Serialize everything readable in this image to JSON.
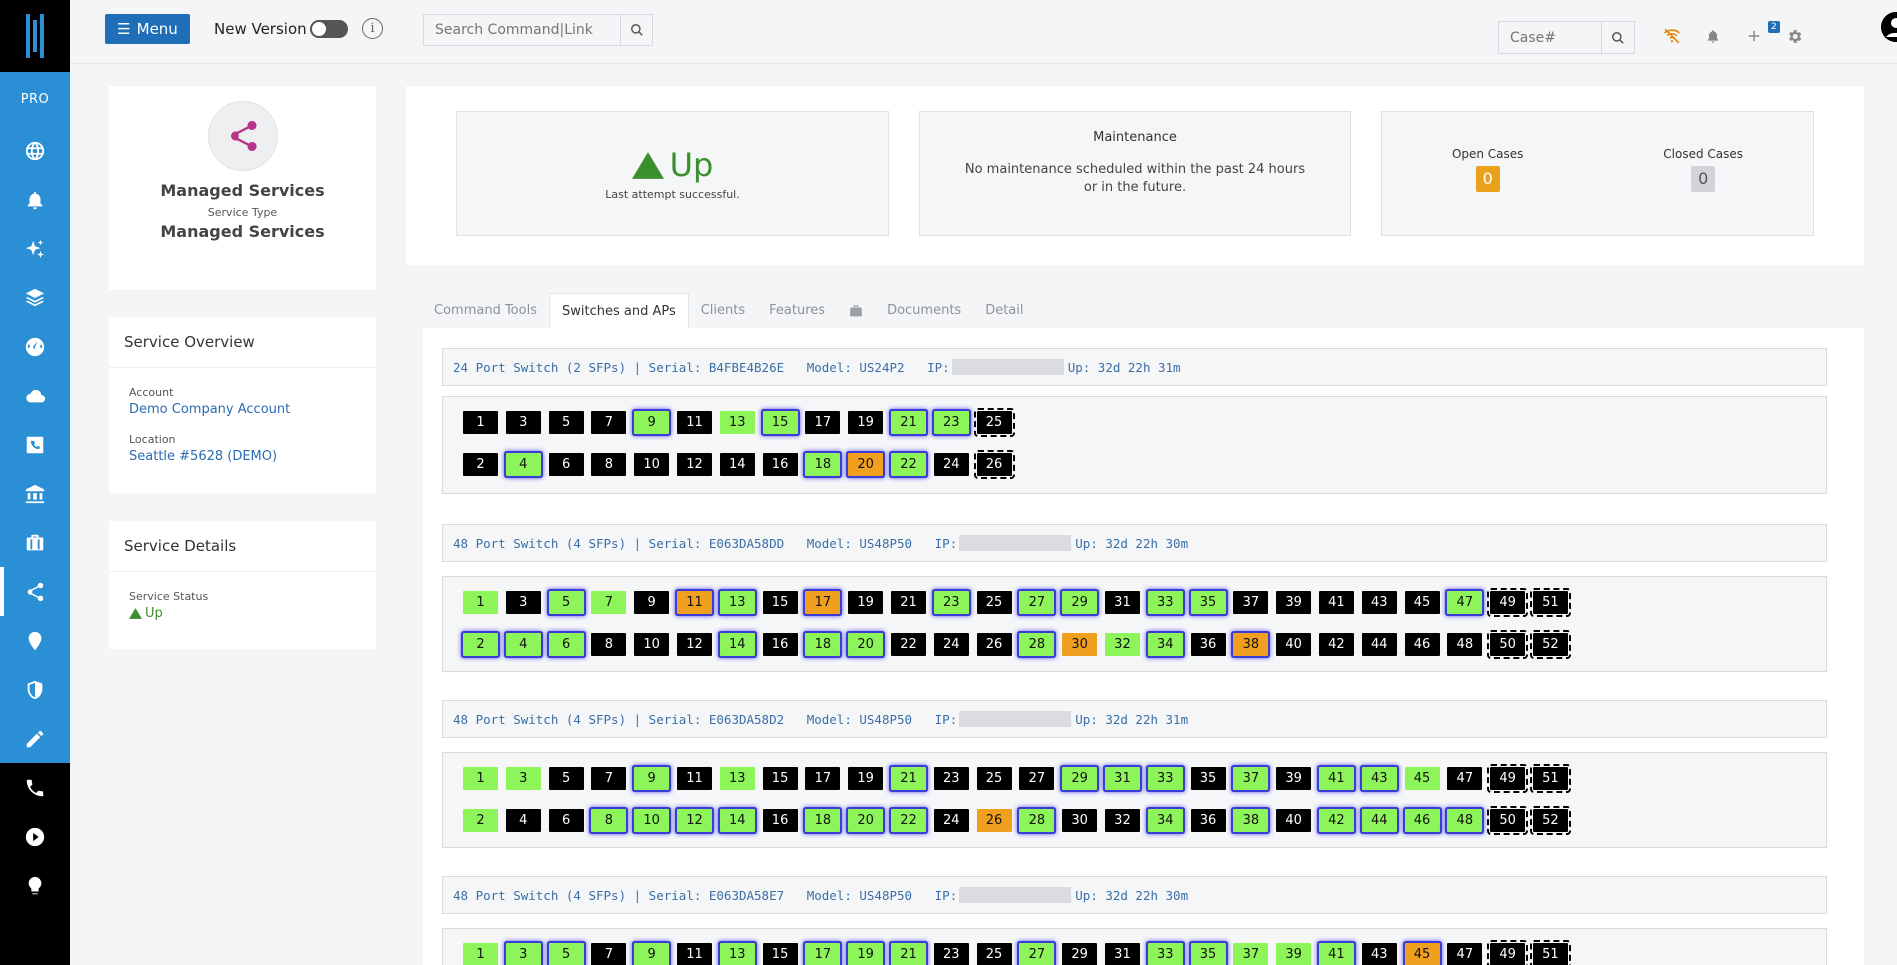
{
  "sidebar": {
    "pro_label": "PRO",
    "items": [
      {
        "icon": "globe-icon"
      },
      {
        "icon": "bell-icon"
      },
      {
        "icon": "sparkle-icon"
      },
      {
        "icon": "layers-icon"
      },
      {
        "icon": "dashboard-icon"
      },
      {
        "icon": "cloud-icon"
      },
      {
        "icon": "phone-square-icon"
      },
      {
        "icon": "bank-icon"
      },
      {
        "icon": "briefcase-icon"
      },
      {
        "icon": "share-icon"
      },
      {
        "icon": "location-pin-icon"
      },
      {
        "icon": "shield-icon"
      },
      {
        "icon": "pencil-icon"
      },
      {
        "icon": "phone-icon"
      },
      {
        "icon": "play-icon"
      },
      {
        "icon": "lightbulb-icon"
      }
    ]
  },
  "topbar": {
    "menu_label": "Menu",
    "new_version_label": "New Version",
    "search_placeholder": "Search Command|Link",
    "case_placeholder": "Case#",
    "notification_count": "2"
  },
  "service": {
    "name": "Managed Services",
    "type_label": "Service Type",
    "type": "Managed Services"
  },
  "overview": {
    "title": "Service Overview",
    "account_label": "Account",
    "account": "Demo Company Account",
    "location_label": "Location",
    "location": "Seattle #5628 (DEMO)"
  },
  "details": {
    "title": "Service Details",
    "status_label": "Service Status",
    "status": "Up"
  },
  "status": {
    "up_text": "Up",
    "up_sub": "Last attempt successful.",
    "maintenance_title": "Maintenance",
    "maintenance_text": "No maintenance scheduled within the past 24 hours or in the future.",
    "open_label": "Open Cases",
    "open_count": "0",
    "closed_label": "Closed Cases",
    "closed_count": "0"
  },
  "tabs": [
    "Command Tools",
    "Switches and APs",
    "Clients",
    "Features",
    "",
    "Documents",
    "Detail"
  ],
  "colors": {
    "brand_blue": "#2a8fd4",
    "up_green": "#3c8f2f",
    "port_green": "#8df55a",
    "port_orange": "#f0a01e",
    "port_black": "#000000"
  },
  "switches": [
    {
      "header": "24 Port Switch (2 SFPs) | Serial: B4FBE4B26E   Model: US24P2   IP:",
      "uptime": "Up: 32d 22h 31m",
      "rows": [
        [
          [
            "1",
            "k"
          ],
          [
            "3",
            "k"
          ],
          [
            "5",
            "k"
          ],
          [
            "7",
            "k"
          ],
          [
            "9",
            "g*"
          ],
          [
            "11",
            "k"
          ],
          [
            "13",
            "g"
          ],
          [
            "15",
            "g*"
          ],
          [
            "17",
            "k"
          ],
          [
            "19",
            "k"
          ],
          [
            "21",
            "g*"
          ],
          [
            "23",
            "g*"
          ],
          [
            "25",
            "s"
          ]
        ],
        [
          [
            "2",
            "k"
          ],
          [
            "4",
            "g*"
          ],
          [
            "6",
            "k"
          ],
          [
            "8",
            "k"
          ],
          [
            "10",
            "k"
          ],
          [
            "12",
            "k"
          ],
          [
            "14",
            "k"
          ],
          [
            "16",
            "k"
          ],
          [
            "18",
            "g*"
          ],
          [
            "20",
            "o*"
          ],
          [
            "22",
            "g*"
          ],
          [
            "24",
            "k"
          ],
          [
            "26",
            "s"
          ]
        ]
      ]
    },
    {
      "header": "48 Port Switch (4 SFPs) | Serial: E063DA58DD   Model: US48P50   IP:",
      "uptime": "Up: 32d 22h 30m",
      "rows": [
        [
          [
            "1",
            "g"
          ],
          [
            "3",
            "k"
          ],
          [
            "5",
            "g*"
          ],
          [
            "7",
            "g"
          ],
          [
            "9",
            "k"
          ],
          [
            "11",
            "o*"
          ],
          [
            "13",
            "g*"
          ],
          [
            "15",
            "k"
          ],
          [
            "17",
            "o*"
          ],
          [
            "19",
            "k"
          ],
          [
            "21",
            "k"
          ],
          [
            "23",
            "g*"
          ],
          [
            "25",
            "k"
          ],
          [
            "27",
            "g*"
          ],
          [
            "29",
            "g*"
          ],
          [
            "31",
            "k"
          ],
          [
            "33",
            "g*"
          ],
          [
            "35",
            "g*"
          ],
          [
            "37",
            "k"
          ],
          [
            "39",
            "k"
          ],
          [
            "41",
            "k"
          ],
          [
            "43",
            "k"
          ],
          [
            "45",
            "k"
          ],
          [
            "47",
            "g*"
          ],
          [
            "49",
            "s"
          ],
          [
            "51",
            "s"
          ]
        ],
        [
          [
            "2",
            "g*"
          ],
          [
            "4",
            "g*"
          ],
          [
            "6",
            "g*"
          ],
          [
            "8",
            "k"
          ],
          [
            "10",
            "k"
          ],
          [
            "12",
            "k"
          ],
          [
            "14",
            "g*"
          ],
          [
            "16",
            "k"
          ],
          [
            "18",
            "g*"
          ],
          [
            "20",
            "g*"
          ],
          [
            "22",
            "k"
          ],
          [
            "24",
            "k"
          ],
          [
            "26",
            "k"
          ],
          [
            "28",
            "g*"
          ],
          [
            "30",
            "o"
          ],
          [
            "32",
            "g"
          ],
          [
            "34",
            "g*"
          ],
          [
            "36",
            "k"
          ],
          [
            "38",
            "o*"
          ],
          [
            "40",
            "k"
          ],
          [
            "42",
            "k"
          ],
          [
            "44",
            "k"
          ],
          [
            "46",
            "k"
          ],
          [
            "48",
            "k"
          ],
          [
            "50",
            "s"
          ],
          [
            "52",
            "s"
          ]
        ]
      ]
    },
    {
      "header": "48 Port Switch (4 SFPs) | Serial: E063DA58D2   Model: US48P50   IP:",
      "uptime": "Up: 32d 22h 31m",
      "rows": [
        [
          [
            "1",
            "g"
          ],
          [
            "3",
            "g"
          ],
          [
            "5",
            "k"
          ],
          [
            "7",
            "k"
          ],
          [
            "9",
            "g*"
          ],
          [
            "11",
            "k"
          ],
          [
            "13",
            "g"
          ],
          [
            "15",
            "k"
          ],
          [
            "17",
            "k"
          ],
          [
            "19",
            "k"
          ],
          [
            "21",
            "g*"
          ],
          [
            "23",
            "k"
          ],
          [
            "25",
            "k"
          ],
          [
            "27",
            "k"
          ],
          [
            "29",
            "g*"
          ],
          [
            "31",
            "g*"
          ],
          [
            "33",
            "g*"
          ],
          [
            "35",
            "k"
          ],
          [
            "37",
            "g*"
          ],
          [
            "39",
            "k"
          ],
          [
            "41",
            "g*"
          ],
          [
            "43",
            "g*"
          ],
          [
            "45",
            "g"
          ],
          [
            "47",
            "k"
          ],
          [
            "49",
            "s"
          ],
          [
            "51",
            "s"
          ]
        ],
        [
          [
            "2",
            "g"
          ],
          [
            "4",
            "k"
          ],
          [
            "6",
            "k"
          ],
          [
            "8",
            "g*"
          ],
          [
            "10",
            "g*"
          ],
          [
            "12",
            "g*"
          ],
          [
            "14",
            "g*"
          ],
          [
            "16",
            "k"
          ],
          [
            "18",
            "g*"
          ],
          [
            "20",
            "g*"
          ],
          [
            "22",
            "g*"
          ],
          [
            "24",
            "k"
          ],
          [
            "26",
            "o"
          ],
          [
            "28",
            "g*"
          ],
          [
            "30",
            "k"
          ],
          [
            "32",
            "k"
          ],
          [
            "34",
            "g*"
          ],
          [
            "36",
            "k"
          ],
          [
            "38",
            "g*"
          ],
          [
            "40",
            "k"
          ],
          [
            "42",
            "g*"
          ],
          [
            "44",
            "g*"
          ],
          [
            "46",
            "g*"
          ],
          [
            "48",
            "g*"
          ],
          [
            "50",
            "s"
          ],
          [
            "52",
            "s"
          ]
        ]
      ]
    },
    {
      "header": "48 Port Switch (4 SFPs) | Serial: E063DA58E7   Model: US48P50   IP:",
      "uptime": "Up: 32d 22h 30m",
      "rows": [
        [
          [
            "1",
            "g"
          ],
          [
            "3",
            "g*"
          ],
          [
            "5",
            "g*"
          ],
          [
            "7",
            "k"
          ],
          [
            "9",
            "g*"
          ],
          [
            "11",
            "k"
          ],
          [
            "13",
            "g*"
          ],
          [
            "15",
            "k"
          ],
          [
            "17",
            "g*"
          ],
          [
            "19",
            "g*"
          ],
          [
            "21",
            "g*"
          ],
          [
            "23",
            "k"
          ],
          [
            "25",
            "k"
          ],
          [
            "27",
            "g*"
          ],
          [
            "29",
            "k"
          ],
          [
            "31",
            "k"
          ],
          [
            "33",
            "g*"
          ],
          [
            "35",
            "g*"
          ],
          [
            "37",
            "g"
          ],
          [
            "39",
            "g"
          ],
          [
            "41",
            "g*"
          ],
          [
            "43",
            "k"
          ],
          [
            "45",
            "o*"
          ],
          [
            "47",
            "k"
          ],
          [
            "49",
            "s"
          ],
          [
            "51",
            "s"
          ]
        ]
      ]
    }
  ]
}
